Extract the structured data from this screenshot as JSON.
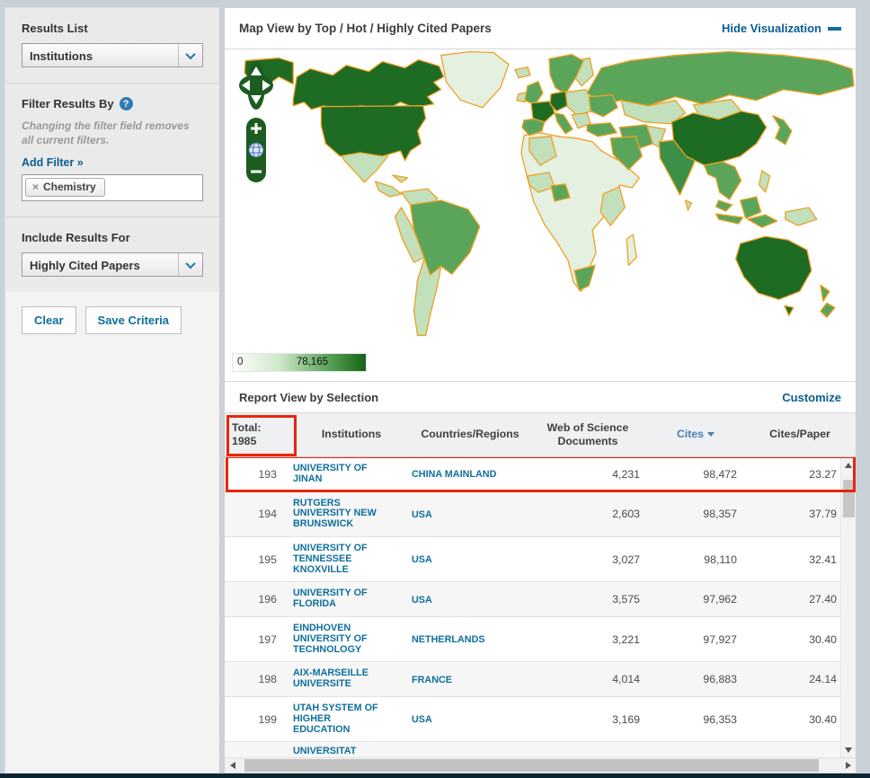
{
  "colors": {
    "outer-bg": "#c9d1d8",
    "link": "#0a5d94",
    "table-link": "#0f6f9d",
    "highlight-red": "#e8260d",
    "map-border": "#efa123",
    "g0": "#e4f0e0",
    "g1": "#c2e0bc",
    "g2": "#5ba55b",
    "g3": "#3c8f47",
    "g4": "#1e6b24",
    "control-green": "#1d5c20"
  },
  "sidebar": {
    "results_list_label": "Results List",
    "results_list_value": "Institutions",
    "filter_by_label": "Filter Results By",
    "help_glyph": "?",
    "filter_note": "Changing the filter field removes all current filters.",
    "add_filter_label": "Add Filter »",
    "filter_tag_remove": "×",
    "filter_tag_label": "Chemistry",
    "include_label": "Include Results For",
    "include_value": "Highly Cited Papers",
    "clear_button": "Clear",
    "save_button": "Save Criteria"
  },
  "map": {
    "title": "Map View by Top / Hot / Highly Cited Papers",
    "hide_link": "Hide Visualization",
    "zoom_in": "+",
    "zoom_out": "−",
    "legend_min": "0",
    "legend_max": "78,165"
  },
  "report": {
    "title": "Report View by Selection",
    "customize_link": "Customize"
  },
  "table": {
    "header": {
      "total_label": "Total:",
      "total_value": "1985",
      "institutions": "Institutions",
      "countries": "Countries/Regions",
      "wos_docs": "Web of Science Documents",
      "cites": "Cites",
      "cites_per_paper": "Cites/Paper"
    },
    "rows": [
      {
        "rank": "193",
        "institution": "UNIVERSITY OF JINAN",
        "country": "CHINA MAINLAND",
        "docs": "4,231",
        "cites": "98,472",
        "cpp": "23.27",
        "highlighted": true
      },
      {
        "rank": "194",
        "institution": "RUTGERS UNIVERSITY NEW BRUNSWICK",
        "country": "USA",
        "docs": "2,603",
        "cites": "98,357",
        "cpp": "37.79"
      },
      {
        "rank": "195",
        "institution": "UNIVERSITY OF TENNESSEE KNOXVILLE",
        "country": "USA",
        "docs": "3,027",
        "cites": "98,110",
        "cpp": "32.41"
      },
      {
        "rank": "196",
        "institution": "UNIVERSITY OF FLORIDA",
        "country": "USA",
        "docs": "3,575",
        "cites": "97,962",
        "cpp": "27.40"
      },
      {
        "rank": "197",
        "institution": "EINDHOVEN UNIVERSITY OF TECHNOLOGY",
        "country": "NETHERLANDS",
        "docs": "3,221",
        "cites": "97,927",
        "cpp": "30.40"
      },
      {
        "rank": "198",
        "institution": "AIX-MARSEILLE UNIVERSITE",
        "country": "FRANCE",
        "docs": "4,014",
        "cites": "96,883",
        "cpp": "24.14"
      },
      {
        "rank": "199",
        "institution": "UTAH SYSTEM OF HIGHER EDUCATION",
        "country": "USA",
        "docs": "3,169",
        "cites": "96,353",
        "cpp": "30.40"
      },
      {
        "rank": "",
        "institution": "UNIVERSITAT",
        "country": "",
        "docs": "",
        "cites": "",
        "cpp": "",
        "partial": true
      }
    ]
  }
}
